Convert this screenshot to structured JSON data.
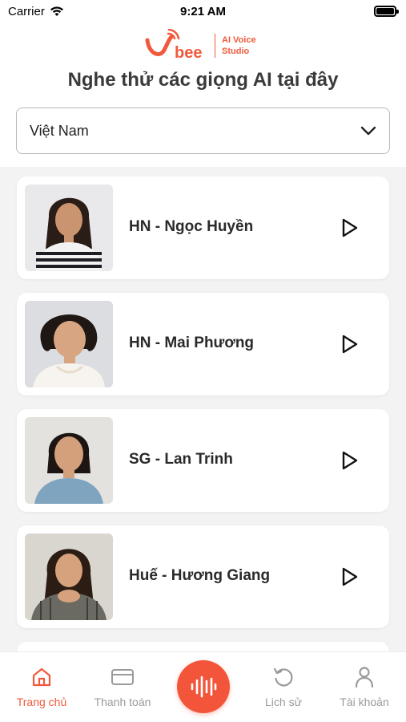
{
  "status_bar": {
    "carrier": "Carrier",
    "time": "9:21 AM"
  },
  "logo": {
    "brand": "bee",
    "line1": "AI Voice",
    "line2": "Studio"
  },
  "page_title": "Nghe thử các giọng AI tại đây",
  "country_select": {
    "value": "Việt Nam"
  },
  "voices": [
    {
      "name": "HN - Ngọc Huyền"
    },
    {
      "name": "HN - Mai Phương"
    },
    {
      "name": "SG - Lan Trinh"
    },
    {
      "name": "Huế - Hương Giang"
    }
  ],
  "tabs": {
    "home": "Trang chủ",
    "payment": "Thanh toán",
    "history": "Lịch sử",
    "account": "Tài khoản"
  },
  "colors": {
    "accent": "#f05a3c",
    "inactive": "#9a9a9a"
  }
}
